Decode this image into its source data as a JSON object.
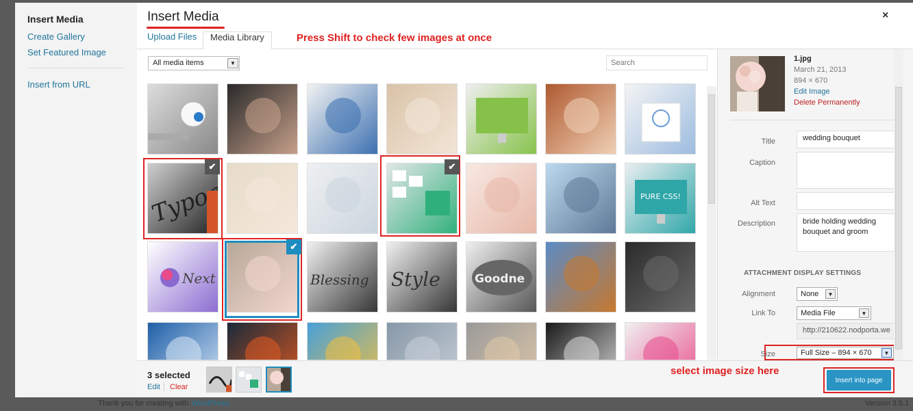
{
  "modal": {
    "title": "Insert Media",
    "close": "×"
  },
  "sidebar": {
    "title": "Insert Media",
    "links": [
      "Create Gallery",
      "Set Featured Image"
    ],
    "url_link": "Insert from URL"
  },
  "tabs": [
    "Upload Files",
    "Media Library"
  ],
  "annotations": {
    "shift": "Press Shift to check few images at once",
    "size": "select image size here"
  },
  "filter": {
    "value": "All media items"
  },
  "search": {
    "placeholder": "Search"
  },
  "tiles": [
    {
      "name": "bulb-hand-thumbnail",
      "c1": "#dcdcdc",
      "c2": "#888"
    },
    {
      "name": "woman-portrait-thumbnail",
      "c1": "#2a2a2a",
      "c2": "#c9a28c"
    },
    {
      "name": "man-thumbs-up-thumbnail",
      "c1": "#f2f2f2",
      "c2": "#3a6fb0"
    },
    {
      "name": "lingerie-thumbnail",
      "c1": "#d9c3a8",
      "c2": "#f3e6d8"
    },
    {
      "name": "imac-green-thumbnail",
      "c1": "#eeeeee",
      "c2": "#86c24a"
    },
    {
      "name": "redhead-thumbnail",
      "c1": "#b05a30",
      "c2": "#f0d2b8"
    },
    {
      "name": "lightbulb-sketch-thumbnail",
      "c1": "#f4f4f4",
      "c2": "#9bbbe0"
    },
    {
      "name": "typography-thumbnail",
      "c1": "#cfcfcf",
      "c2": "#222"
    },
    {
      "name": "blonde-thumbnail",
      "c1": "#e6dcc8",
      "c2": "#f5e8dc"
    },
    {
      "name": "business-woman-thumbnail",
      "c1": "#eef0f2",
      "c2": "#cbd5de"
    },
    {
      "name": "keyboard-thumbnail",
      "c1": "#e2e6e8",
      "c2": "#2fb07a"
    },
    {
      "name": "dream-portrait-thumbnail",
      "c1": "#f7e8e2",
      "c2": "#e7b8a8"
    },
    {
      "name": "skydiver-thumbnail",
      "c1": "#bcd9ee",
      "c2": "#5c7896"
    },
    {
      "name": "imac-purecss-thumbnail",
      "c1": "#e9eef0",
      "c2": "#2fa6a8"
    },
    {
      "name": "next-logo-thumbnail",
      "c1": "#ffffff",
      "c2": "#8a6ad0"
    },
    {
      "name": "wedding-bouquet-thumbnail",
      "c1": "#b7a898",
      "c2": "#f3d7d0"
    },
    {
      "name": "blessing-thumbnail",
      "c1": "#f0f0f0",
      "c2": "#333"
    },
    {
      "name": "style-thumbnail",
      "c1": "#f0f0f0",
      "c2": "#333"
    },
    {
      "name": "goodness-thumbnail",
      "c1": "#efefef",
      "c2": "#555"
    },
    {
      "name": "autumn-house-thumbnail",
      "c1": "#5b8bc5",
      "c2": "#c8782c"
    },
    {
      "name": "success-thumbnail",
      "c1": "#2b2b2b",
      "c2": "#6a6a6a"
    },
    {
      "name": "blue-abstract-thumbnail",
      "c1": "#1f5fa8",
      "c2": "#d8e8f6"
    },
    {
      "name": "fire-ice-thumbnail",
      "c1": "#1b2a3a",
      "c2": "#e05a20"
    },
    {
      "name": "paper-toys-thumbnail",
      "c1": "#48a0d8",
      "c2": "#f2c040"
    },
    {
      "name": "city-thumbnail",
      "c1": "#8898a8",
      "c2": "#c8d0d8"
    },
    {
      "name": "blonde-grey-thumbnail",
      "c1": "#9a9a9a",
      "c2": "#e0c8a8"
    },
    {
      "name": "chalkboard-thumbnail",
      "c1": "#1a1a1a",
      "c2": "#dddddd"
    },
    {
      "name": "ideas-head-thumbnail",
      "c1": "#f0f0f0",
      "c2": "#e84a8a"
    }
  ],
  "tile_texts": {
    "next": "Next",
    "blessing": "Blessing",
    "style": "Style",
    "goodness": "Goodne",
    "typo": "Typog",
    "purecss": "PURE CSS!"
  },
  "details": {
    "filename": "1.jpg",
    "date": "March 21, 2013",
    "dimensions": "894 × 670",
    "edit": "Edit Image",
    "delete": "Delete Permanently",
    "title_label": "Title",
    "title_value": "wedding bouquet",
    "caption_label": "Caption",
    "caption_value": "",
    "alt_label": "Alt Text",
    "alt_value": "",
    "desc_label": "Description",
    "desc_value": "bride holding wedding bouquet and groom",
    "settings_heading": "ATTACHMENT DISPLAY SETTINGS",
    "align_label": "Alignment",
    "align_value": "None",
    "link_label": "Link To",
    "link_value": "Media File",
    "url_value": "http://210622.nodporta.we",
    "size_label": "Size",
    "size_value": "Full Size – 894 × 670"
  },
  "footer": {
    "selected": "3 selected",
    "edit": "Edit",
    "clear": "Clear",
    "insert": "Insert into page"
  },
  "bottom": {
    "thanks": "Thank you for creating with",
    "wp": "WordPress.",
    "version": "Version 3.5.1"
  },
  "colors": {
    "link": "#21759b",
    "annotation": "#e02020",
    "primary": "#2a95c5"
  }
}
